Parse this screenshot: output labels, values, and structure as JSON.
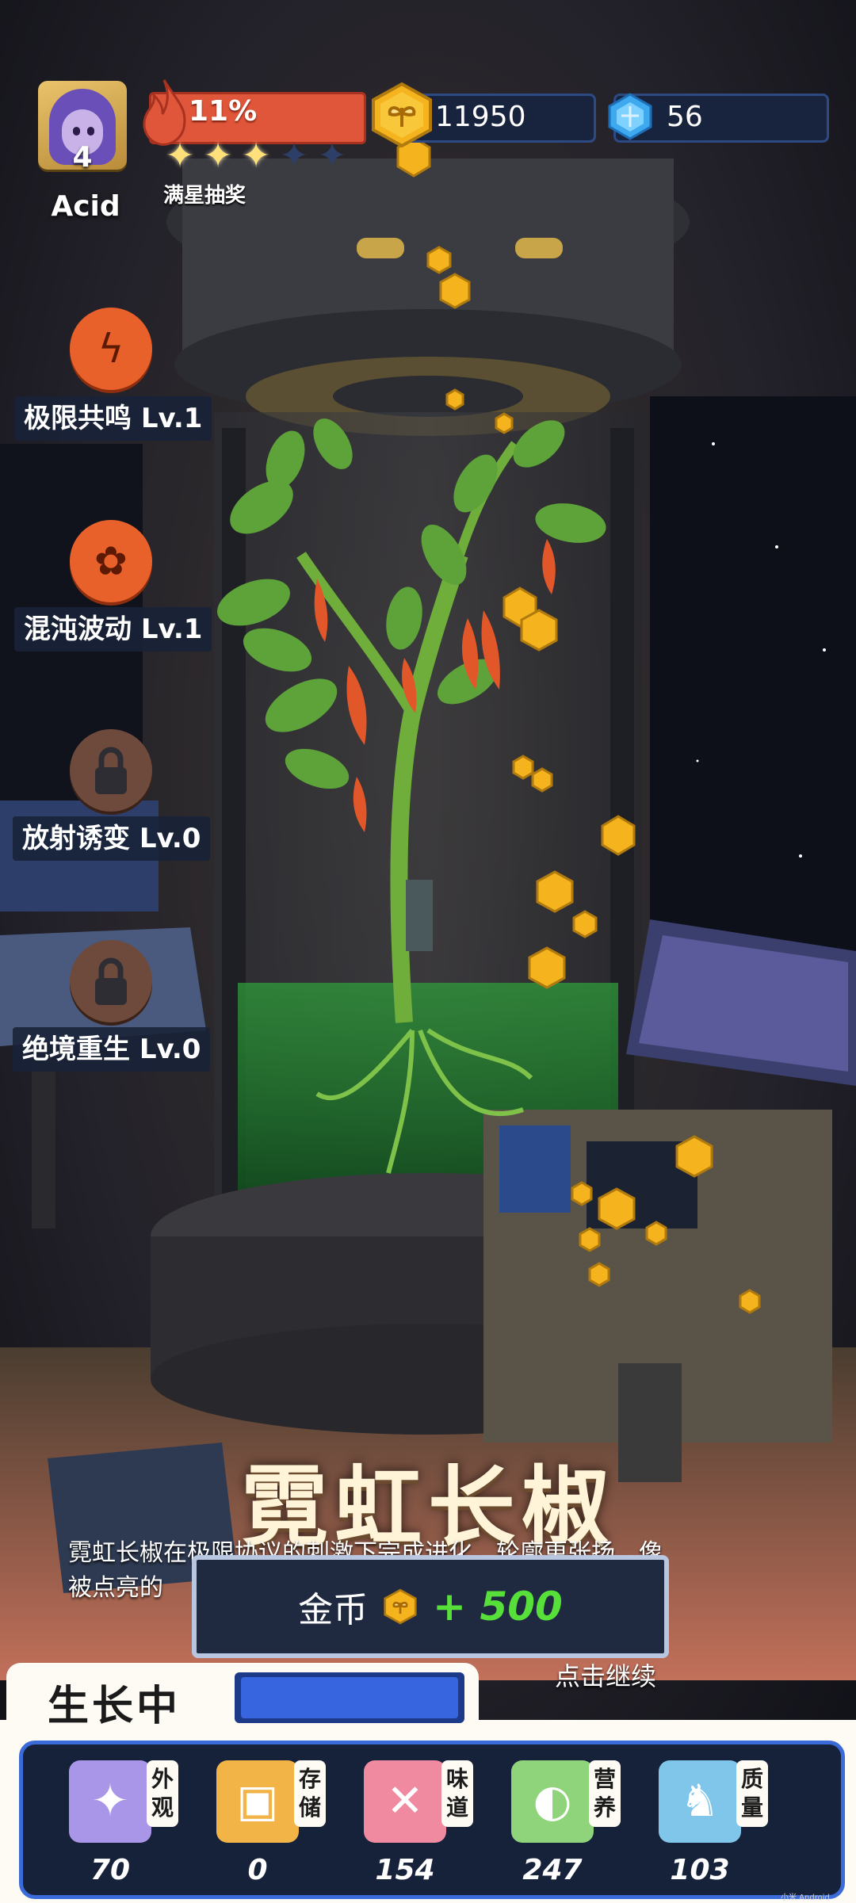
{
  "player": {
    "name": "Acid",
    "level": "4",
    "xp_percent_label": "11%",
    "xp_fraction": 0.11,
    "stars_filled": 3,
    "stars_total": 5,
    "star_caption": "满星抽奖"
  },
  "currency": {
    "gold": "11950",
    "gems": "56"
  },
  "skills": [
    {
      "label": "极限共鸣 Lv.1",
      "icon": "resonance-icon",
      "locked": false
    },
    {
      "label": "混沌波动 Lv.1",
      "icon": "chaos-wave-icon",
      "locked": false
    },
    {
      "label": "放射诱变 Lv.0",
      "icon": "lock-icon",
      "locked": true
    },
    {
      "label": "绝境重生 Lv.0",
      "icon": "lock-icon",
      "locked": true
    }
  ],
  "evolution": {
    "title": "霓虹长椒",
    "description_line1": "霓虹长椒在极限协议的刺激下完成进化，轮廓更张扬，像",
    "description_line2": "被点亮的",
    "reward_label": "金币",
    "reward_amount": "+ 500",
    "continue_hint": "点击继续"
  },
  "growth": {
    "label": "生长中",
    "progress_fraction": 1.0
  },
  "stats": [
    {
      "tag": "外观",
      "value": "70",
      "icon": "sparkle-icon",
      "color": "#a996e8"
    },
    {
      "tag": "存储",
      "value": "0",
      "icon": "box-icon",
      "color": "#f2b347"
    },
    {
      "tag": "味道",
      "value": "154",
      "icon": "fork-knife-icon",
      "color": "#f08aa0"
    },
    {
      "tag": "营养",
      "value": "247",
      "icon": "lemon-icon",
      "color": "#8fd47a"
    },
    {
      "tag": "质量",
      "value": "103",
      "icon": "muscle-icon",
      "color": "#7fc6ea"
    }
  ],
  "colors": {
    "accent_blue": "#3764df",
    "xp_red": "#e0563a",
    "gold": "#f5b41e",
    "reward_green": "#58e03a"
  },
  "watermark": "小米 Android"
}
